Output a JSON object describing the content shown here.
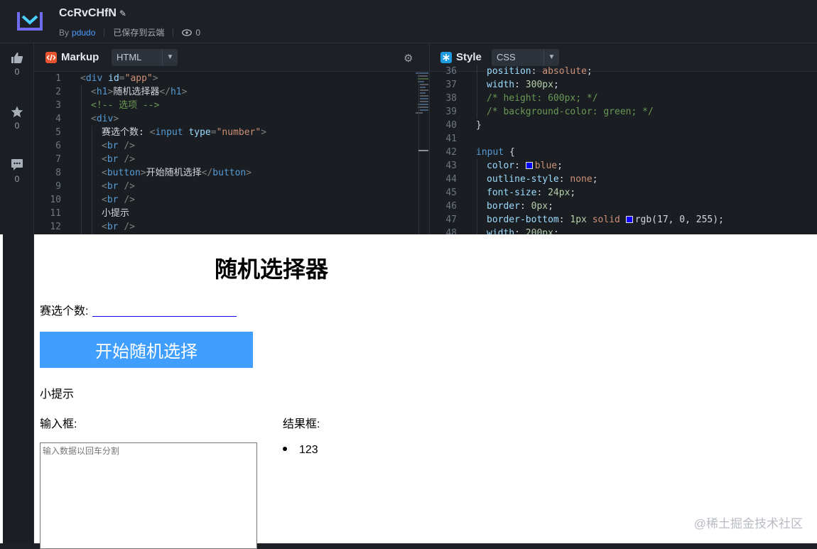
{
  "header": {
    "project_title": "CcRvCHfN",
    "by_label": "By",
    "author": "pdudo",
    "save_status": "已保存到云端",
    "view_count": "0"
  },
  "rail": {
    "like_count": "0",
    "star_count": "0",
    "comment_count": "0"
  },
  "markup_pane": {
    "title": "Markup",
    "language": "HTML",
    "lines": [
      {
        "n": "1",
        "indent": 0,
        "parts": [
          [
            "t-punc",
            "<"
          ],
          [
            "t-tag",
            "div "
          ],
          [
            "t-attr",
            "id"
          ],
          [
            "t-punc",
            "="
          ],
          [
            "t-str",
            "\"app\""
          ],
          [
            "t-punc",
            ">"
          ]
        ]
      },
      {
        "n": "2",
        "indent": 1,
        "parts": [
          [
            "t-punc",
            "<"
          ],
          [
            "t-tag",
            "h1"
          ],
          [
            "t-punc",
            ">"
          ],
          [
            "",
            "随机选择器"
          ],
          [
            "t-punc",
            "</"
          ],
          [
            "t-tag",
            "h1"
          ],
          [
            "t-punc",
            ">"
          ]
        ]
      },
      {
        "n": "3",
        "indent": 1,
        "parts": [
          [
            "t-com",
            "<!-- 选项 -->"
          ]
        ]
      },
      {
        "n": "4",
        "indent": 1,
        "parts": [
          [
            "t-punc",
            "<"
          ],
          [
            "t-tag",
            "div"
          ],
          [
            "t-punc",
            ">"
          ]
        ]
      },
      {
        "n": "5",
        "indent": 2,
        "parts": [
          [
            "",
            "赛选个数: "
          ],
          [
            "t-punc",
            "<"
          ],
          [
            "t-tag",
            "input "
          ],
          [
            "t-attr",
            "type"
          ],
          [
            "t-punc",
            "="
          ],
          [
            "t-str",
            "\"number\""
          ],
          [
            "t-punc",
            ">"
          ]
        ]
      },
      {
        "n": "6",
        "indent": 2,
        "parts": [
          [
            "t-punc",
            "<"
          ],
          [
            "t-tag",
            "br "
          ],
          [
            "t-punc",
            "/>"
          ]
        ]
      },
      {
        "n": "7",
        "indent": 2,
        "parts": [
          [
            "t-punc",
            "<"
          ],
          [
            "t-tag",
            "br "
          ],
          [
            "t-punc",
            "/>"
          ]
        ]
      },
      {
        "n": "8",
        "indent": 2,
        "parts": [
          [
            "t-punc",
            "<"
          ],
          [
            "t-tag",
            "button"
          ],
          [
            "t-punc",
            ">"
          ],
          [
            "",
            "开始随机选择"
          ],
          [
            "t-punc",
            "</"
          ],
          [
            "t-tag",
            "button"
          ],
          [
            "t-punc",
            ">"
          ]
        ]
      },
      {
        "n": "9",
        "indent": 2,
        "parts": [
          [
            "t-punc",
            "<"
          ],
          [
            "t-tag",
            "br "
          ],
          [
            "t-punc",
            "/>"
          ]
        ]
      },
      {
        "n": "10",
        "indent": 2,
        "parts": [
          [
            "t-punc",
            "<"
          ],
          [
            "t-tag",
            "br "
          ],
          [
            "t-punc",
            "/>"
          ]
        ]
      },
      {
        "n": "11",
        "indent": 2,
        "parts": [
          [
            "",
            "小提示"
          ]
        ]
      },
      {
        "n": "12",
        "indent": 2,
        "parts": [
          [
            "t-punc",
            "<"
          ],
          [
            "t-tag",
            "br "
          ],
          [
            "t-punc",
            "/>"
          ]
        ]
      }
    ]
  },
  "style_pane": {
    "title": "Style",
    "language": "CSS",
    "lines": [
      {
        "n": "36",
        "indent": 1,
        "parts": [
          [
            "t-prop",
            "position"
          ],
          [
            "",
            ": "
          ],
          [
            "t-val",
            "absolute"
          ],
          [
            "",
            ";"
          ]
        ]
      },
      {
        "n": "37",
        "indent": 1,
        "parts": [
          [
            "t-prop",
            "width"
          ],
          [
            "",
            ": "
          ],
          [
            "t-num",
            "300px"
          ],
          [
            "",
            ";"
          ]
        ]
      },
      {
        "n": "38",
        "indent": 1,
        "parts": [
          [
            "t-com",
            "/* height: 600px; */"
          ]
        ]
      },
      {
        "n": "39",
        "indent": 1,
        "parts": [
          [
            "t-com",
            "/* background-color: green; */"
          ]
        ]
      },
      {
        "n": "40",
        "indent": 0,
        "parts": [
          [
            "",
            "}"
          ]
        ]
      },
      {
        "n": "41",
        "indent": 0,
        "parts": [
          [
            "",
            ""
          ]
        ]
      },
      {
        "n": "42",
        "indent": 0,
        "parts": [
          [
            "t-tag",
            "input"
          ],
          [
            "",
            " {"
          ]
        ]
      },
      {
        "n": "43",
        "indent": 1,
        "parts": [
          [
            "t-prop",
            "color"
          ],
          [
            "",
            ": "
          ],
          [
            "swatch",
            "#0000ff"
          ],
          [
            "t-val",
            "blue"
          ],
          [
            "",
            ";"
          ]
        ]
      },
      {
        "n": "44",
        "indent": 1,
        "parts": [
          [
            "t-prop",
            "outline-style"
          ],
          [
            "",
            ": "
          ],
          [
            "t-val",
            "none"
          ],
          [
            "",
            ";"
          ]
        ]
      },
      {
        "n": "45",
        "indent": 1,
        "parts": [
          [
            "t-prop",
            "font-size"
          ],
          [
            "",
            ": "
          ],
          [
            "t-num",
            "24px"
          ],
          [
            "",
            ";"
          ]
        ]
      },
      {
        "n": "46",
        "indent": 1,
        "parts": [
          [
            "t-prop",
            "border"
          ],
          [
            "",
            ": "
          ],
          [
            "t-num",
            "0px"
          ],
          [
            "",
            ";"
          ]
        ]
      },
      {
        "n": "47",
        "indent": 1,
        "parts": [
          [
            "t-prop",
            "border-bottom"
          ],
          [
            "",
            ": "
          ],
          [
            "t-num",
            "1px "
          ],
          [
            "t-val",
            "solid "
          ],
          [
            "swatch",
            "#1100ff"
          ],
          [
            "",
            "rgb(17, 0, 255);"
          ]
        ]
      },
      {
        "n": "48",
        "indent": 1,
        "parts": [
          [
            "t-prop",
            "width"
          ],
          [
            "",
            ": "
          ],
          [
            "t-num",
            "200px"
          ],
          [
            "",
            ";"
          ]
        ]
      }
    ]
  },
  "preview": {
    "heading": "随机选择器",
    "count_label": "赛选个数:",
    "start_button": "开始随机选择",
    "tip": "小提示",
    "input_label": "输入框:",
    "result_label": "结果框:",
    "textarea_placeholder": "输入数据以回车分割",
    "result_item": "123"
  },
  "watermark": "@稀土掘金技术社区",
  "colors": {
    "accent_blue": "#409eff",
    "link_blue": "#4d9bff",
    "input_underline": "#1100ff"
  }
}
